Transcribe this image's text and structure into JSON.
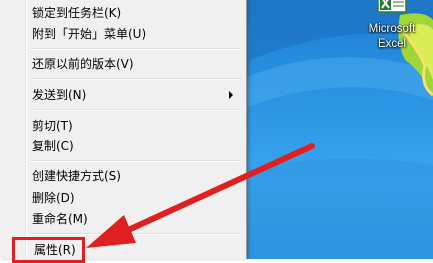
{
  "context_menu": {
    "items": [
      {
        "label": "锁定到任务栏(K)"
      },
      {
        "label": "附到「开始」菜单(U)"
      },
      {
        "label": "还原以前的版本(V)"
      },
      {
        "label": "发送到(N)"
      },
      {
        "label": "剪切(T)"
      },
      {
        "label": "复制(C)"
      },
      {
        "label": "创建快捷方式(S)"
      },
      {
        "label": "删除(D)"
      },
      {
        "label": "重命名(M)"
      },
      {
        "label": "属性(R)"
      }
    ],
    "highlighted_item": "属性(R)"
  },
  "desktop": {
    "shortcut": {
      "label_line1": "Microsoft",
      "label_line2": "Excel",
      "icon": "excel-icon"
    }
  },
  "annotation": {
    "arrow_color": "#e02020",
    "highlight_color": "#e02020"
  }
}
